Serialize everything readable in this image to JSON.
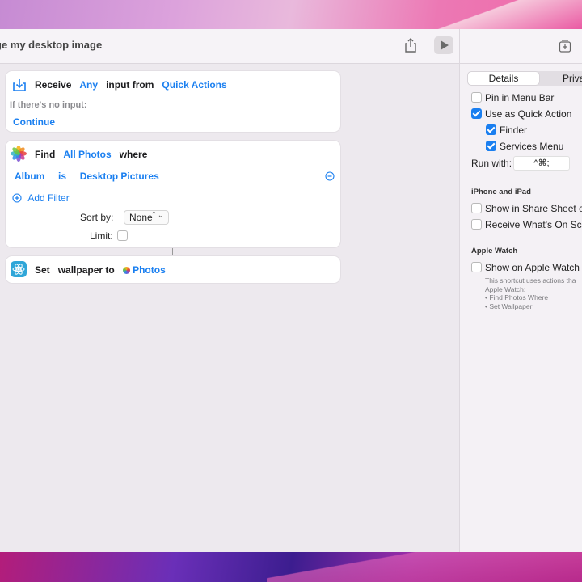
{
  "window": {
    "title": "ge my desktop image"
  },
  "receive_action": {
    "verb": "Receive",
    "input_type": "Any",
    "input_from_label": "input from",
    "source": "Quick Actions",
    "no_input_label": "If there's no input:",
    "no_input_value": "Continue"
  },
  "find_action": {
    "verb": "Find",
    "target": "All Photos",
    "where_label": "where",
    "filter_field": "Album",
    "filter_op": "is",
    "filter_value": "Desktop Pictures",
    "add_filter_label": "Add Filter",
    "sort_by_label": "Sort by:",
    "sort_by_value": "None",
    "limit_label": "Limit:"
  },
  "set_action": {
    "verb": "Set",
    "text": "wallpaper to",
    "variable": "Photos"
  },
  "sidebar": {
    "tabs": [
      "Details",
      "Priva"
    ],
    "selected_tab": "Details",
    "pin_menu_bar": "Pin in Menu Bar",
    "use_quick_action": "Use as Quick Action",
    "finder": "Finder",
    "services_menu": "Services Menu",
    "run_with_label": "Run with:",
    "run_with_value": "^⌘;",
    "iphone_header": "iPhone and iPad",
    "share_sheet": "Show in Share Sheet on",
    "receive_screen": "Receive What's On Scre",
    "watch_header": "Apple Watch",
    "show_on_watch": "Show on Apple Watch",
    "note_lines": [
      "This shortcut uses actions tha",
      "Apple Watch:",
      "• Find Photos Where",
      "• Set Wallpaper"
    ]
  },
  "colors": {
    "accent": "#1a7ff0"
  }
}
